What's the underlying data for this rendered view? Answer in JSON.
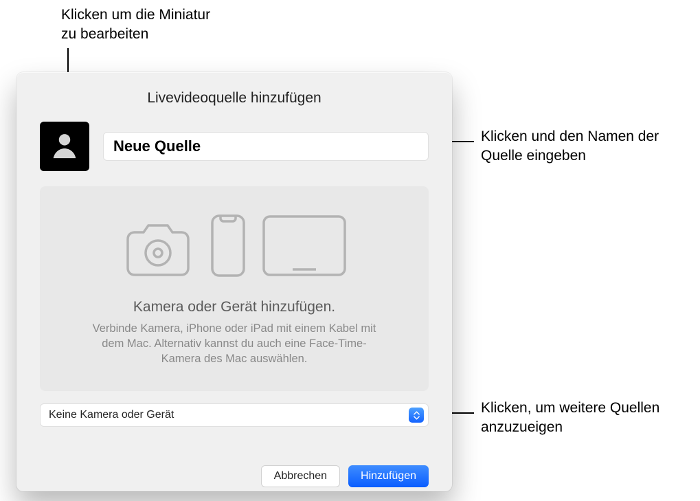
{
  "callouts": {
    "thumbnail": "Klicken um die Miniatur\nzu bearbeiten",
    "name": "Klicken und den Namen der Quelle eingeben",
    "select": "Klicken, um weitere Quellen anzuzueigen"
  },
  "dialog": {
    "title": "Livevideoquelle hinzufügen",
    "source_name": "Neue Quelle",
    "placeholder": {
      "title": "Kamera oder Gerät hinzufügen.",
      "text": "Verbinde Kamera, iPhone oder iPad mit einem Kabel mit dem Mac. Alternativ kannst du auch eine Face-Time-Kamera des Mac auswählen."
    },
    "select_value": "Keine Kamera oder Gerät",
    "buttons": {
      "cancel": "Abbrechen",
      "add": "Hinzufügen"
    }
  }
}
